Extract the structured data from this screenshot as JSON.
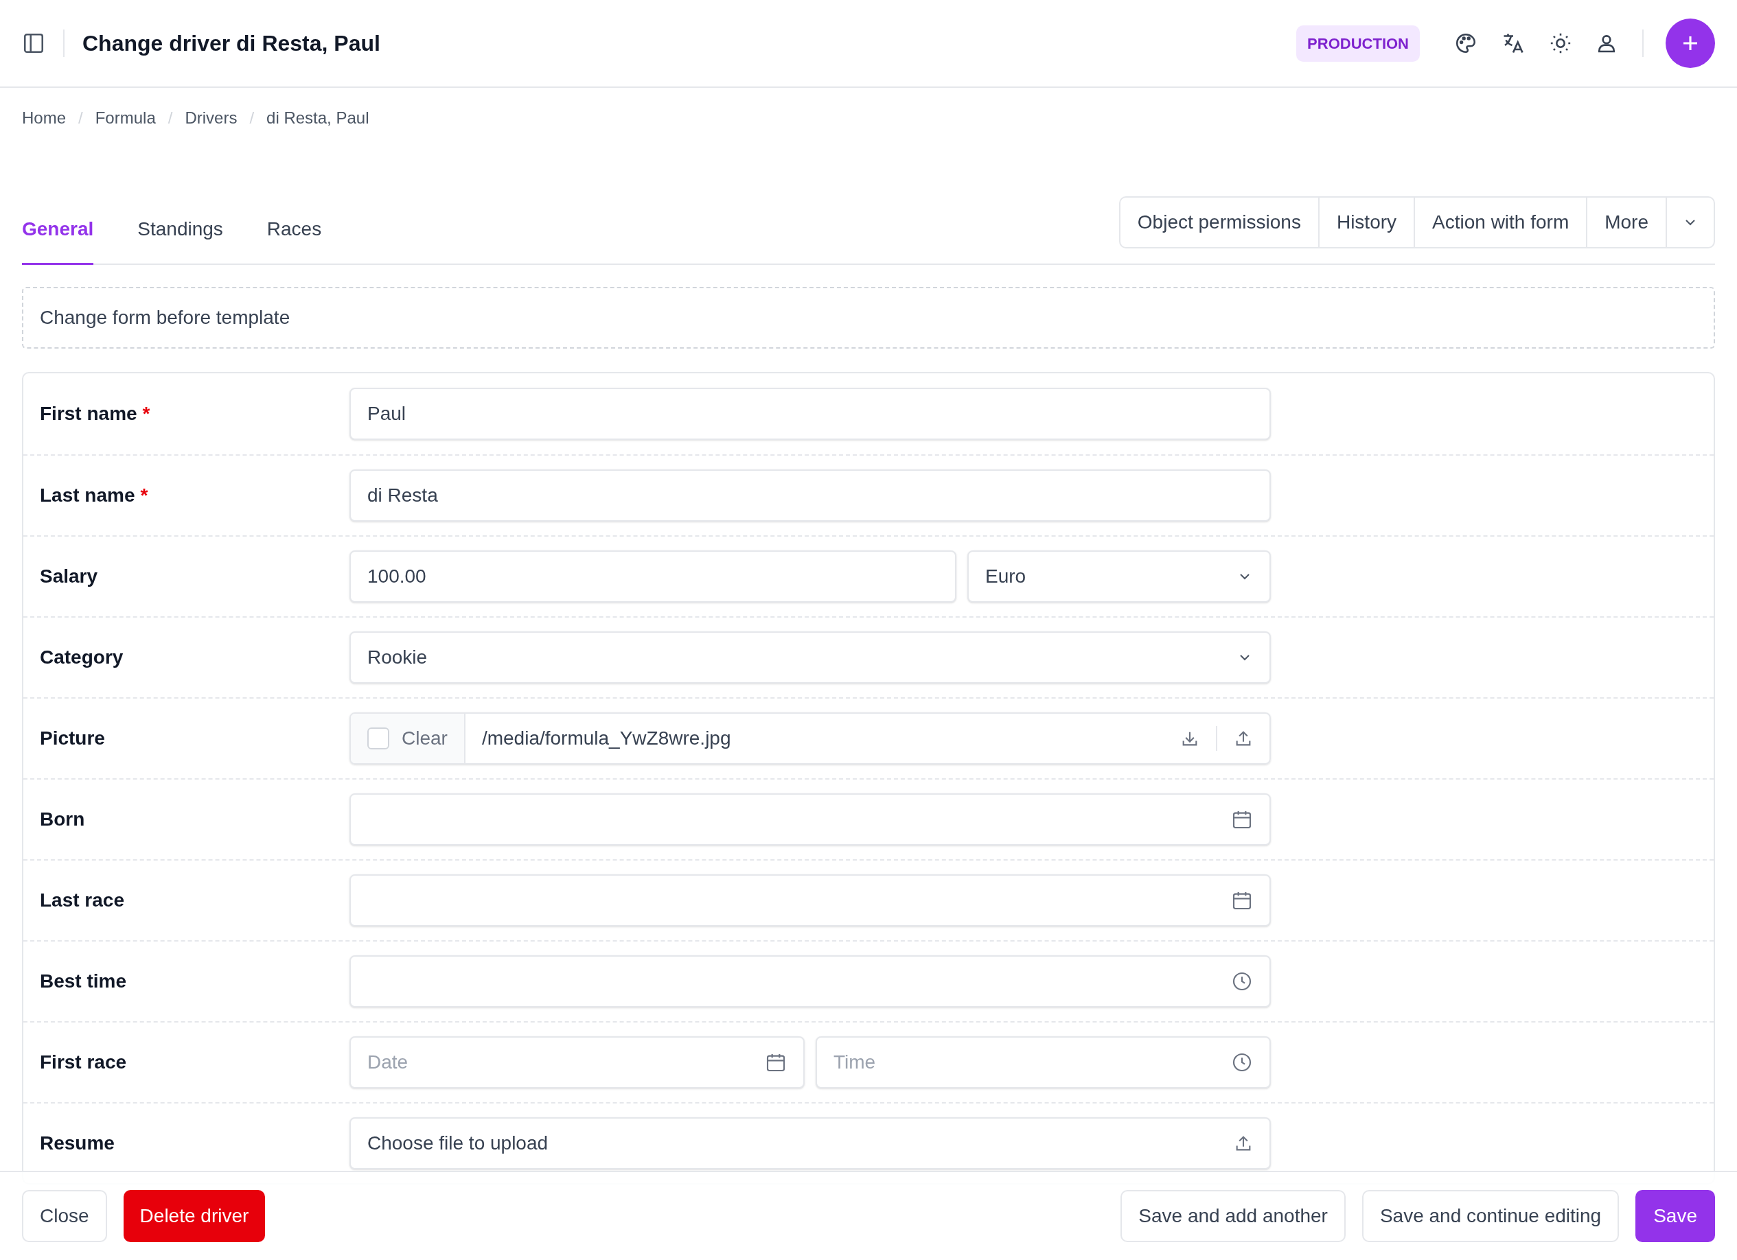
{
  "header": {
    "title": "Change driver di Resta, Paul",
    "badge": "PRODUCTION"
  },
  "breadcrumbs": [
    {
      "label": "Home"
    },
    {
      "separator": "/",
      "label": "Formula"
    },
    {
      "separator": "/",
      "label": "Drivers"
    },
    {
      "separator": "/",
      "label": "di Resta, Paul"
    }
  ],
  "tabs": [
    {
      "label": "General",
      "selected": true
    },
    {
      "label": "Standings",
      "selected": false
    },
    {
      "label": "Races",
      "selected": false
    }
  ],
  "actions": [
    "Object permissions",
    "History",
    "Action with form",
    "More"
  ],
  "notice": "Change form before template",
  "fields": [
    {
      "kind": "text",
      "label": "First name",
      "required_mark": "*",
      "value": "Paul"
    },
    {
      "kind": "text",
      "label": "Last name",
      "required_mark": "*",
      "value": "di Resta"
    },
    {
      "kind": "money",
      "label": "Salary",
      "value": "100.00",
      "currency": "Euro"
    },
    {
      "kind": "select",
      "label": "Category",
      "value": "Rookie"
    },
    {
      "kind": "file",
      "label": "Picture",
      "clear_label": "Clear",
      "clear_checked": false,
      "value": "/media/formula_YwZ8wre.jpg"
    },
    {
      "kind": "date",
      "label": "Born"
    },
    {
      "kind": "date",
      "label": "Last race"
    },
    {
      "kind": "time",
      "label": "Best time"
    },
    {
      "kind": "datetime",
      "label": "First race",
      "date_placeholder": "Date",
      "time_placeholder": "Time"
    },
    {
      "kind": "upload",
      "label": "Resume",
      "text": "Choose file to upload"
    }
  ],
  "footer": {
    "close": "Close",
    "delete": "Delete driver",
    "save_add": "Save and add another",
    "save_continue": "Save and continue editing",
    "save": "Save"
  }
}
